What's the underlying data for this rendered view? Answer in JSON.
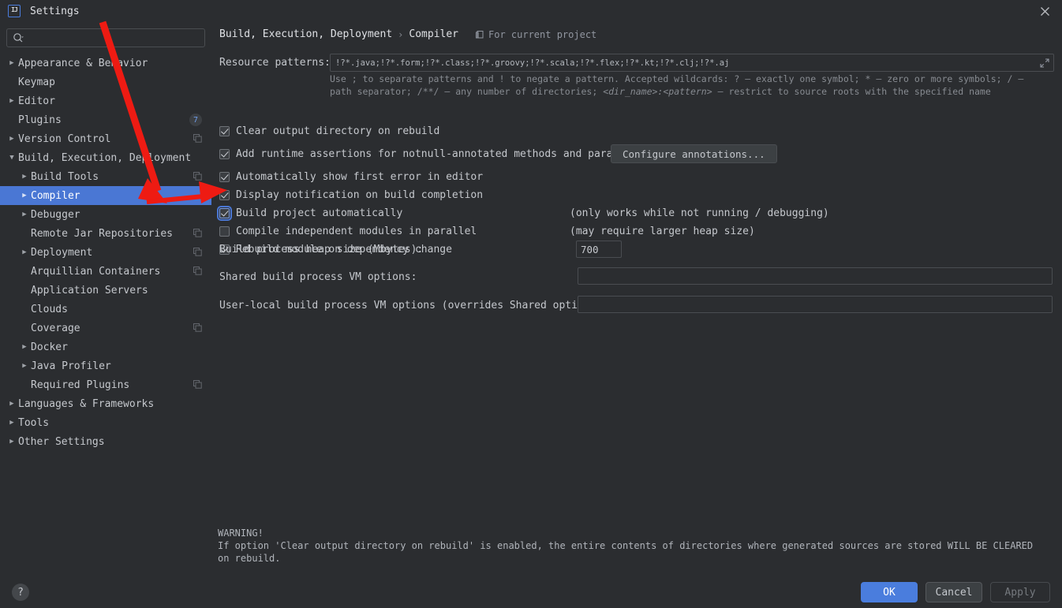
{
  "window": {
    "title": "Settings",
    "logo_text": "IJ",
    "close_icon": "close-icon"
  },
  "sidebar": {
    "search": {
      "value": "",
      "placeholder": "",
      "icon": "search-icon"
    },
    "items": [
      {
        "label": "Appearance & Behavior",
        "twisty": "collapsed",
        "indent": 0,
        "badge": "",
        "copy": false,
        "selected": false
      },
      {
        "label": "Keymap",
        "twisty": "none",
        "indent": 0,
        "badge": "",
        "copy": false,
        "selected": false
      },
      {
        "label": "Editor",
        "twisty": "collapsed",
        "indent": 0,
        "badge": "",
        "copy": false,
        "selected": false
      },
      {
        "label": "Plugins",
        "twisty": "none",
        "indent": 0,
        "badge": "7",
        "copy": false,
        "selected": false
      },
      {
        "label": "Version Control",
        "twisty": "collapsed",
        "indent": 0,
        "badge": "",
        "copy": true,
        "selected": false
      },
      {
        "label": "Build, Execution, Deployment",
        "twisty": "expanded",
        "indent": 0,
        "badge": "",
        "copy": false,
        "selected": false
      },
      {
        "label": "Build Tools",
        "twisty": "collapsed",
        "indent": 1,
        "badge": "",
        "copy": true,
        "selected": false
      },
      {
        "label": "Compiler",
        "twisty": "collapsed",
        "indent": 1,
        "badge": "",
        "copy": false,
        "selected": true
      },
      {
        "label": "Debugger",
        "twisty": "collapsed",
        "indent": 1,
        "badge": "",
        "copy": false,
        "selected": false
      },
      {
        "label": "Remote Jar Repositories",
        "twisty": "none",
        "indent": 1,
        "badge": "",
        "copy": true,
        "selected": false
      },
      {
        "label": "Deployment",
        "twisty": "collapsed",
        "indent": 1,
        "badge": "",
        "copy": true,
        "selected": false
      },
      {
        "label": "Arquillian Containers",
        "twisty": "none",
        "indent": 1,
        "badge": "",
        "copy": true,
        "selected": false
      },
      {
        "label": "Application Servers",
        "twisty": "none",
        "indent": 1,
        "badge": "",
        "copy": false,
        "selected": false
      },
      {
        "label": "Clouds",
        "twisty": "none",
        "indent": 1,
        "badge": "",
        "copy": false,
        "selected": false
      },
      {
        "label": "Coverage",
        "twisty": "none",
        "indent": 1,
        "badge": "",
        "copy": true,
        "selected": false
      },
      {
        "label": "Docker",
        "twisty": "collapsed",
        "indent": 1,
        "badge": "",
        "copy": false,
        "selected": false
      },
      {
        "label": "Java Profiler",
        "twisty": "collapsed",
        "indent": 1,
        "badge": "",
        "copy": false,
        "selected": false
      },
      {
        "label": "Required Plugins",
        "twisty": "none",
        "indent": 1,
        "badge": "",
        "copy": true,
        "selected": false
      },
      {
        "label": "Languages & Frameworks",
        "twisty": "collapsed",
        "indent": 0,
        "badge": "",
        "copy": false,
        "selected": false
      },
      {
        "label": "Tools",
        "twisty": "collapsed",
        "indent": 0,
        "badge": "",
        "copy": false,
        "selected": false
      },
      {
        "label": "Other Settings",
        "twisty": "collapsed",
        "indent": 0,
        "badge": "",
        "copy": false,
        "selected": false
      }
    ]
  },
  "main": {
    "breadcrumb_root": "Build, Execution, Deployment",
    "breadcrumb_sep": "›",
    "breadcrumb_leaf": "Compiler",
    "for_current_project": "For current project",
    "resource_patterns_label": "Resource patterns:",
    "resource_patterns_value": "!?*.java;!?*.form;!?*.class;!?*.groovy;!?*.scala;!?*.flex;!?*.kt;!?*.clj;!?*.aj",
    "hint_line1": "Use ; to separate patterns and ! to negate a pattern. Accepted wildcards: ? — exactly one symbol; * — zero or more symbols; / —",
    "hint_line2_a": "path separator; /**/ — any number of directories; ",
    "hint_line2_i": "<dir_name>:<pattern>",
    "hint_line2_b": " — restrict to source roots with the specified name",
    "checkboxes": [
      {
        "label": "Clear output directory on rebuild",
        "checked": true,
        "focused": false,
        "note": ""
      },
      {
        "label": "Add runtime assertions for notnull-annotated methods and parameters",
        "checked": true,
        "focused": false,
        "note": ""
      },
      {
        "label": "Automatically show first error in editor",
        "checked": true,
        "focused": false,
        "note": ""
      },
      {
        "label": "Display notification on build completion",
        "checked": true,
        "focused": false,
        "note": ""
      },
      {
        "label": "Build project automatically",
        "checked": true,
        "focused": true,
        "note": "(only works while not running / debugging)"
      },
      {
        "label": "Compile independent modules in parallel",
        "checked": false,
        "focused": false,
        "note": "(may require larger heap size)"
      },
      {
        "label": "Rebuild module on dependency change",
        "checked": true,
        "focused": false,
        "note": ""
      }
    ],
    "configure_annotations_label": "Configure annotations...",
    "heap_label": "Build process heap size (Mbytes):",
    "heap_value": "700",
    "shared_vm_label": "Shared build process VM options:",
    "shared_vm_value": "",
    "user_vm_label": "User-local build process VM options (overrides Shared options):",
    "user_vm_value": "",
    "warning_title": "WARNING!",
    "warning_body": "If option 'Clear output directory on rebuild' is enabled, the entire contents of directories where generated sources are stored WILL BE CLEARED on rebuild."
  },
  "footer": {
    "help_label": "?",
    "ok_label": "OK",
    "cancel_label": "Cancel",
    "apply_label": "Apply"
  },
  "colors": {
    "background": "#2b2d30",
    "selection": "#4a77d4",
    "accent": "#4a7ddd",
    "annotation_red": "#ee1b13",
    "badge_text": "#6f9dea"
  }
}
